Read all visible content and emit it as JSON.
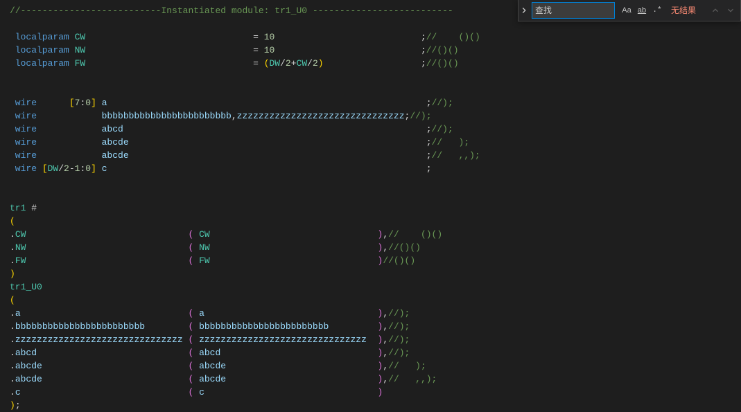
{
  "find": {
    "label": "查找",
    "value": "",
    "opt_case": "Aa",
    "opt_word": "ab",
    "opt_regex": ".*",
    "results": "无结果"
  },
  "lines": [
    [
      {
        "t": "//--------------------------",
        "c": "c-comment"
      },
      {
        "t": "Instantiated module: tr1_U0 ",
        "c": "c-comment"
      },
      {
        "t": "--------------------------",
        "c": "c-comment"
      }
    ],
    [],
    [
      {
        "t": " localparam ",
        "c": "c-keyword"
      },
      {
        "t": "CW                               ",
        "c": "c-ident"
      },
      {
        "t": "= ",
        "c": "c-text"
      },
      {
        "t": "10                           ",
        "c": "c-number"
      },
      {
        "t": ";",
        "c": "c-semi"
      },
      {
        "t": "//    ()()",
        "c": "c-comment"
      }
    ],
    [
      {
        "t": " localparam ",
        "c": "c-keyword"
      },
      {
        "t": "NW                               ",
        "c": "c-ident"
      },
      {
        "t": "= ",
        "c": "c-text"
      },
      {
        "t": "10                           ",
        "c": "c-number"
      },
      {
        "t": ";",
        "c": "c-semi"
      },
      {
        "t": "//()()",
        "c": "c-comment"
      }
    ],
    [
      {
        "t": " localparam ",
        "c": "c-keyword"
      },
      {
        "t": "FW                               ",
        "c": "c-ident"
      },
      {
        "t": "= ",
        "c": "c-text"
      },
      {
        "t": "(",
        "c": "c-brace"
      },
      {
        "t": "DW",
        "c": "c-ident"
      },
      {
        "t": "/",
        "c": "c-text"
      },
      {
        "t": "2",
        "c": "c-number"
      },
      {
        "t": "+",
        "c": "c-text"
      },
      {
        "t": "CW",
        "c": "c-ident"
      },
      {
        "t": "/",
        "c": "c-text"
      },
      {
        "t": "2",
        "c": "c-number"
      },
      {
        "t": ")                  ",
        "c": "c-brace"
      },
      {
        "t": ";",
        "c": "c-semi"
      },
      {
        "t": "//()()",
        "c": "c-comment"
      }
    ],
    [],
    [],
    [
      {
        "t": " wire      ",
        "c": "c-keyword"
      },
      {
        "t": "[",
        "c": "c-brace"
      },
      {
        "t": "7",
        "c": "c-number"
      },
      {
        "t": ":",
        "c": "c-text"
      },
      {
        "t": "0",
        "c": "c-number"
      },
      {
        "t": "] ",
        "c": "c-brace"
      },
      {
        "t": "a                                                           ",
        "c": "c-ff"
      },
      {
        "t": ";",
        "c": "c-semi"
      },
      {
        "t": "//);",
        "c": "c-comment"
      }
    ],
    [
      {
        "t": " wire            ",
        "c": "c-keyword"
      },
      {
        "t": "bbbbbbbbbbbbbbbbbbbbbbbb",
        "c": "c-ff"
      },
      {
        "t": ",",
        "c": "c-text"
      },
      {
        "t": "zzzzzzzzzzzzzzzzzzzzzzzzzzzzzzz",
        "c": "c-ff"
      },
      {
        "t": ";",
        "c": "c-semi"
      },
      {
        "t": "//);",
        "c": "c-comment"
      }
    ],
    [
      {
        "t": " wire            ",
        "c": "c-keyword"
      },
      {
        "t": "abcd                                                        ",
        "c": "c-ff"
      },
      {
        "t": ";",
        "c": "c-semi"
      },
      {
        "t": "//);",
        "c": "c-comment"
      }
    ],
    [
      {
        "t": " wire            ",
        "c": "c-keyword"
      },
      {
        "t": "abcde                                                       ",
        "c": "c-ff"
      },
      {
        "t": ";",
        "c": "c-semi"
      },
      {
        "t": "//   );",
        "c": "c-comment"
      }
    ],
    [
      {
        "t": " wire            ",
        "c": "c-keyword"
      },
      {
        "t": "abcde                                                       ",
        "c": "c-ff"
      },
      {
        "t": ";",
        "c": "c-semi"
      },
      {
        "t": "//   ,,);",
        "c": "c-comment"
      }
    ],
    [
      {
        "t": " wire ",
        "c": "c-keyword"
      },
      {
        "t": "[",
        "c": "c-brace"
      },
      {
        "t": "DW",
        "c": "c-ident"
      },
      {
        "t": "/",
        "c": "c-text"
      },
      {
        "t": "2",
        "c": "c-number"
      },
      {
        "t": "-",
        "c": "c-text"
      },
      {
        "t": "1",
        "c": "c-number"
      },
      {
        "t": ":",
        "c": "c-text"
      },
      {
        "t": "0",
        "c": "c-number"
      },
      {
        "t": "] ",
        "c": "c-brace"
      },
      {
        "t": "c                                                           ",
        "c": "c-ff"
      },
      {
        "t": ";",
        "c": "c-semi"
      }
    ],
    [],
    [],
    [
      {
        "t": "tr1 ",
        "c": "c-ident"
      },
      {
        "t": "#",
        "c": "c-text"
      }
    ],
    [
      {
        "t": "(",
        "c": "c-brace"
      }
    ],
    [
      {
        "t": ".",
        "c": "c-text"
      },
      {
        "t": "CW                              ",
        "c": "c-ident"
      },
      {
        "t": "( ",
        "c": "c-paren"
      },
      {
        "t": "CW                               ",
        "c": "c-ident"
      },
      {
        "t": ")",
        "c": "c-paren"
      },
      {
        "t": ",",
        "c": "c-text"
      },
      {
        "t": "//    ()()",
        "c": "c-comment"
      }
    ],
    [
      {
        "t": ".",
        "c": "c-text"
      },
      {
        "t": "NW                              ",
        "c": "c-ident"
      },
      {
        "t": "( ",
        "c": "c-paren"
      },
      {
        "t": "NW                               ",
        "c": "c-ident"
      },
      {
        "t": ")",
        "c": "c-paren"
      },
      {
        "t": ",",
        "c": "c-text"
      },
      {
        "t": "//()()",
        "c": "c-comment"
      }
    ],
    [
      {
        "t": ".",
        "c": "c-text"
      },
      {
        "t": "FW                              ",
        "c": "c-ident"
      },
      {
        "t": "( ",
        "c": "c-paren"
      },
      {
        "t": "FW                               ",
        "c": "c-ident"
      },
      {
        "t": ")",
        "c": "c-paren"
      },
      {
        "t": "//()()",
        "c": "c-comment"
      }
    ],
    [
      {
        "t": ")",
        "c": "c-brace"
      }
    ],
    [
      {
        "t": "tr1_U0",
        "c": "c-ident"
      }
    ],
    [
      {
        "t": "(",
        "c": "c-brace"
      }
    ],
    [
      {
        "t": ".",
        "c": "c-text"
      },
      {
        "t": "a                               ",
        "c": "c-ff"
      },
      {
        "t": "( ",
        "c": "c-paren"
      },
      {
        "t": "a                                ",
        "c": "c-ff"
      },
      {
        "t": ")",
        "c": "c-paren"
      },
      {
        "t": ",",
        "c": "c-text"
      },
      {
        "t": "//);",
        "c": "c-comment"
      }
    ],
    [
      {
        "t": ".",
        "c": "c-text"
      },
      {
        "t": "bbbbbbbbbbbbbbbbbbbbbbbb        ",
        "c": "c-ff"
      },
      {
        "t": "( ",
        "c": "c-paren"
      },
      {
        "t": "bbbbbbbbbbbbbbbbbbbbbbbb         ",
        "c": "c-ff"
      },
      {
        "t": ")",
        "c": "c-paren"
      },
      {
        "t": ",",
        "c": "c-text"
      },
      {
        "t": "//);",
        "c": "c-comment"
      }
    ],
    [
      {
        "t": ".",
        "c": "c-text"
      },
      {
        "t": "zzzzzzzzzzzzzzzzzzzzzzzzzzzzzzz ",
        "c": "c-ff"
      },
      {
        "t": "( ",
        "c": "c-paren"
      },
      {
        "t": "zzzzzzzzzzzzzzzzzzzzzzzzzzzzzzz  ",
        "c": "c-ff"
      },
      {
        "t": ")",
        "c": "c-paren"
      },
      {
        "t": ",",
        "c": "c-text"
      },
      {
        "t": "//);",
        "c": "c-comment"
      }
    ],
    [
      {
        "t": ".",
        "c": "c-text"
      },
      {
        "t": "abcd                            ",
        "c": "c-ff"
      },
      {
        "t": "( ",
        "c": "c-paren"
      },
      {
        "t": "abcd                             ",
        "c": "c-ff"
      },
      {
        "t": ")",
        "c": "c-paren"
      },
      {
        "t": ",",
        "c": "c-text"
      },
      {
        "t": "//);",
        "c": "c-comment"
      }
    ],
    [
      {
        "t": ".",
        "c": "c-text"
      },
      {
        "t": "abcde                           ",
        "c": "c-ff"
      },
      {
        "t": "( ",
        "c": "c-paren"
      },
      {
        "t": "abcde                            ",
        "c": "c-ff"
      },
      {
        "t": ")",
        "c": "c-paren"
      },
      {
        "t": ",",
        "c": "c-text"
      },
      {
        "t": "//   );",
        "c": "c-comment"
      }
    ],
    [
      {
        "t": ".",
        "c": "c-text"
      },
      {
        "t": "abcde                           ",
        "c": "c-ff"
      },
      {
        "t": "( ",
        "c": "c-paren"
      },
      {
        "t": "abcde                            ",
        "c": "c-ff"
      },
      {
        "t": ")",
        "c": "c-paren"
      },
      {
        "t": ",",
        "c": "c-text"
      },
      {
        "t": "//   ,,);",
        "c": "c-comment"
      }
    ],
    [
      {
        "t": ".",
        "c": "c-text"
      },
      {
        "t": "c                               ",
        "c": "c-ff"
      },
      {
        "t": "( ",
        "c": "c-paren"
      },
      {
        "t": "c                                ",
        "c": "c-ff"
      },
      {
        "t": ")",
        "c": "c-paren"
      }
    ],
    [
      {
        "t": ")",
        "c": "c-brace"
      },
      {
        "t": ";",
        "c": "c-semi"
      }
    ]
  ]
}
